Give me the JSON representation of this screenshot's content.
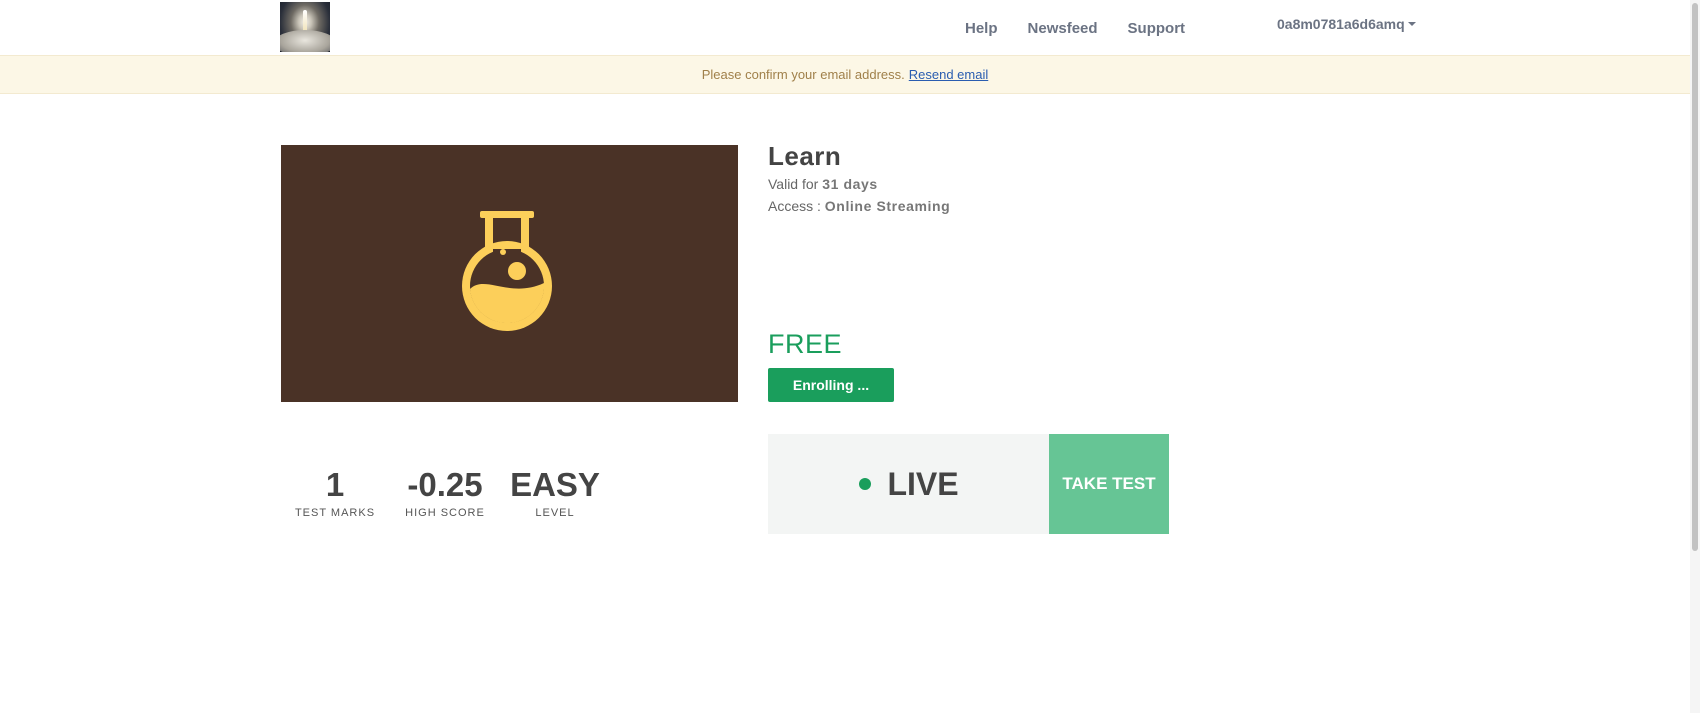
{
  "nav": {
    "links": [
      "Help",
      "Newsfeed",
      "Support"
    ],
    "username": "0a8m0781a6d6amq"
  },
  "alert": {
    "message": "Please confirm your email address.",
    "link_label": "Resend email"
  },
  "course": {
    "icon": "flask-icon",
    "image_background": "#4a3226",
    "icon_color": "#fccf5a",
    "title": "Learn",
    "validity_prefix": "Valid for",
    "validity_value": "31 days",
    "access_prefix": "Access :",
    "access_value": "Online Streaming",
    "price": "FREE",
    "enroll_label": "Enrolling ..."
  },
  "stats": [
    {
      "value": "1",
      "label": "TEST MARKS"
    },
    {
      "value": "-0.25",
      "label": "HIGH SCORE"
    },
    {
      "value": "EASY",
      "label": "LEVEL"
    }
  ],
  "live": {
    "status": "LIVE",
    "action_label": "TAKE TEST"
  },
  "colors": {
    "accent_green": "#1a9e5c",
    "take_test_green": "#66c595",
    "alert_bg": "#fcf7e6"
  }
}
